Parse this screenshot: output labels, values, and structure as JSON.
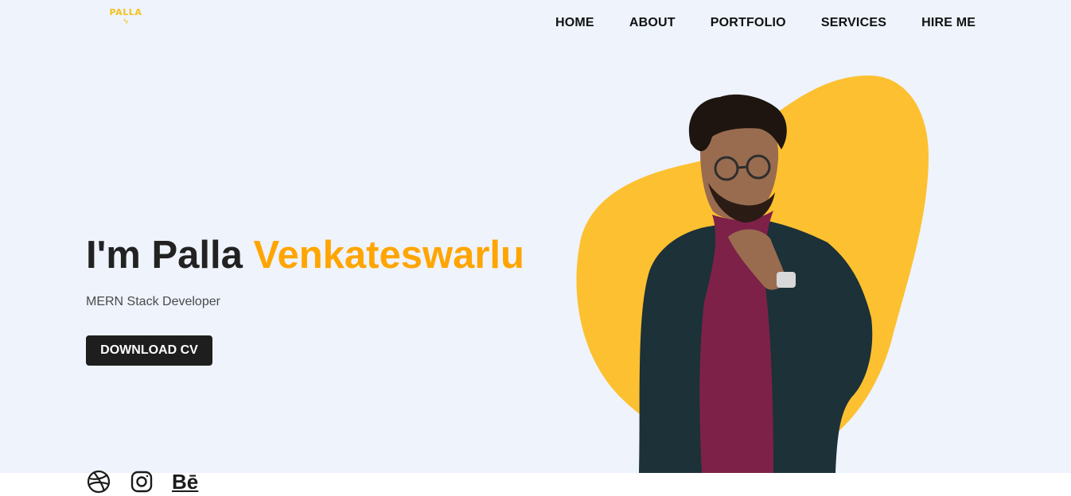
{
  "brand": {
    "logo_text": "PALLA"
  },
  "nav": {
    "items": [
      {
        "label": "HOME"
      },
      {
        "label": "ABOUT"
      },
      {
        "label": "PORTFOLIO"
      },
      {
        "label": "SERVICES"
      },
      {
        "label": "HIRE ME"
      }
    ]
  },
  "hero": {
    "greeting": "I'm Palla ",
    "name_highlight": "Venkateswarlu",
    "subtitle": "MERN Stack Developer",
    "cta_label": "DOWNLOAD CV"
  },
  "social": {
    "behance_label": "Bē",
    "icons": [
      "dribbble-icon",
      "instagram-icon",
      "behance-icon"
    ]
  },
  "colors": {
    "accent": "#ffa500",
    "blob": "#fdc030",
    "background": "#eef3fc",
    "button": "#1e1e1e"
  }
}
